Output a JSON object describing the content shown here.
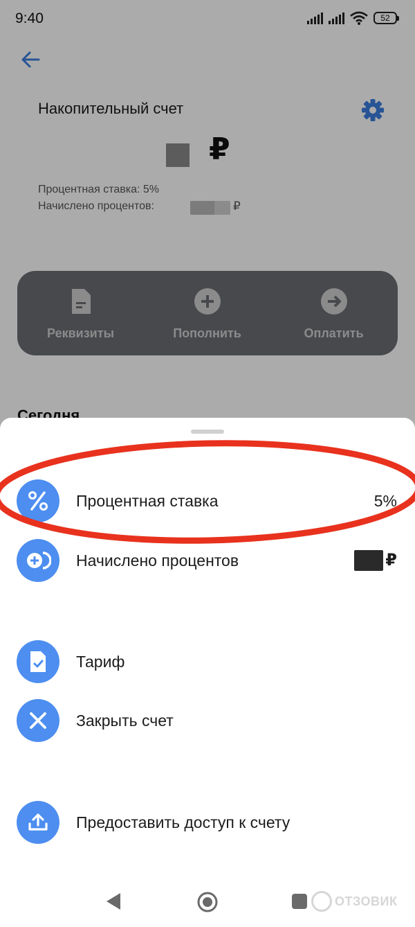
{
  "status_bar": {
    "time": "9:40",
    "battery": "52"
  },
  "account": {
    "title": "Накопительный счет",
    "currency": "₽",
    "info_rate": "Процентная ставка: 5%",
    "info_accrued": "Начислено процентов:",
    "info_accrued_currency": "₽"
  },
  "actions": [
    {
      "label": "Реквизиты",
      "icon": "document-icon"
    },
    {
      "label": "Пополнить",
      "icon": "plus-circle-icon"
    },
    {
      "label": "Оплатить",
      "icon": "arrow-right-circle-icon"
    }
  ],
  "section": {
    "title": "Сегодня"
  },
  "sheet": {
    "items": [
      {
        "label": "Процентная ставка",
        "value": "5%",
        "icon": "percent-icon"
      },
      {
        "label": "Начислено процентов",
        "value": "₽",
        "icon": "interest-icon"
      },
      {
        "label": "Тариф",
        "icon": "tariff-document-icon"
      },
      {
        "label": "Закрыть счет",
        "icon": "close-icon"
      },
      {
        "label": "Предоставить доступ к счету",
        "icon": "share-upload-icon"
      }
    ]
  },
  "colors": {
    "accent": "#4d8ef0",
    "highlight_annotation": "#e8321e",
    "action_panel": "#6b6e73"
  },
  "watermark": {
    "text": "ОТЗОВИК"
  }
}
